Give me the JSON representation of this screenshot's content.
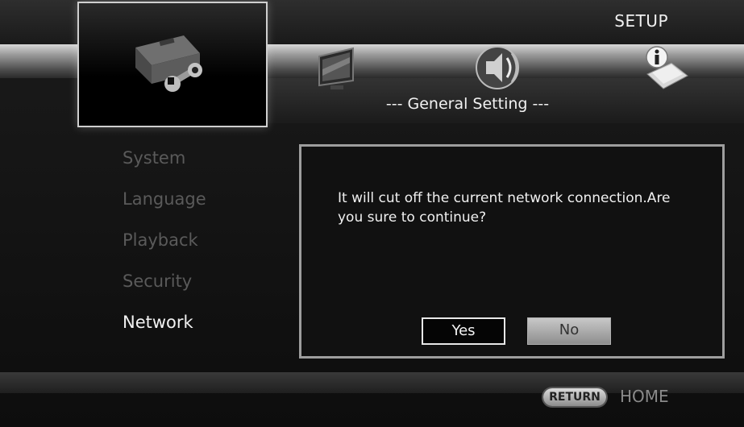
{
  "header": {
    "title": "SETUP"
  },
  "tabs": [
    {
      "name": "general",
      "icon": "toolbox-icon"
    },
    {
      "name": "display",
      "icon": "tv-icon"
    },
    {
      "name": "audio",
      "icon": "speaker-icon"
    },
    {
      "name": "information",
      "icon": "info-icon"
    }
  ],
  "section": {
    "title": "--- General Setting ---"
  },
  "sidebar": {
    "items": [
      {
        "label": "System"
      },
      {
        "label": "Language"
      },
      {
        "label": "Playback"
      },
      {
        "label": "Security"
      },
      {
        "label": "Network"
      }
    ],
    "active": "Network"
  },
  "dialog": {
    "message": "It will cut off the current network connection.Are you sure to continue?",
    "yes_label": "Yes",
    "no_label": "No"
  },
  "footer": {
    "return_label": "RETURN",
    "home_label": "HOME"
  },
  "colors": {
    "background": "#101010",
    "highlight_border": "#cfcfcf",
    "dialog_border": "#9e9e9e"
  }
}
